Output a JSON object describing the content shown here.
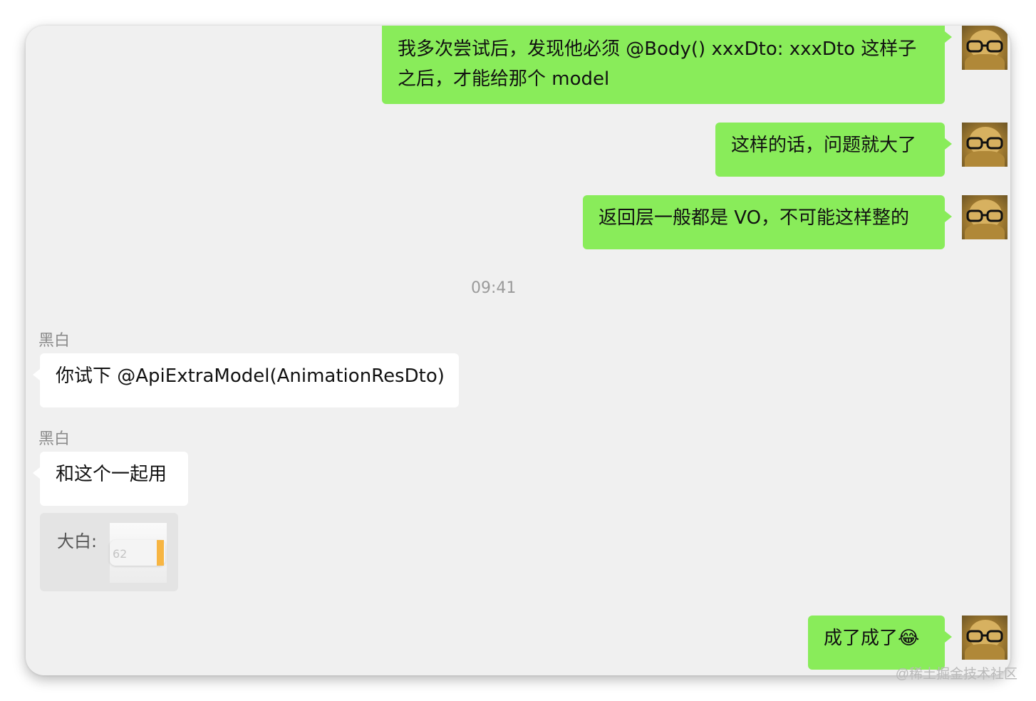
{
  "messages": {
    "m1": {
      "line1": "我多次尝试后，发现他必须 @Body() xxxDto: xxxDto 这样子",
      "line2": "之后，才能给那个 model"
    },
    "m2": {
      "text": "这样的话，问题就大了"
    },
    "m3": {
      "text": "返回层一般都是 VO，不可能这样整的"
    },
    "timestamp": "09:41",
    "m4": {
      "sender": "黑白",
      "text": "你试下 @ApiExtraModel(AnimationResDto)"
    },
    "m5": {
      "sender": "黑白",
      "text": "和这个一起用"
    },
    "quote": {
      "name": "大白:",
      "thumb_number": "62"
    },
    "m6": {
      "text": "成了成了😂"
    }
  },
  "watermark": "@稀土掘金技术社区",
  "colors": {
    "outgoing_bubble": "#89ec5a",
    "incoming_bubble": "#ffffff",
    "chat_background": "#f0f0f0"
  },
  "icons": {
    "avatar": "user-avatar-icon"
  }
}
